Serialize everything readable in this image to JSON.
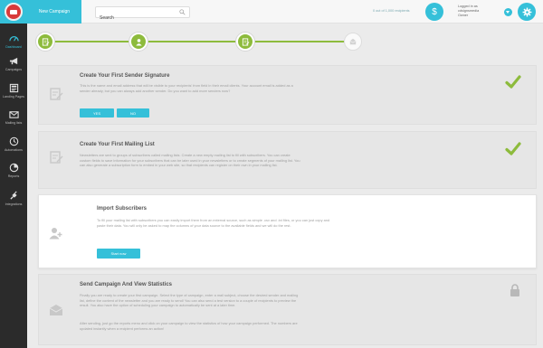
{
  "sidebar": {
    "items": [
      {
        "label": "Dashboard",
        "icon": "dashboard-icon"
      },
      {
        "label": "Campaigns",
        "icon": "megaphone-icon"
      },
      {
        "label": "Landing Pages",
        "icon": "landing-page-icon"
      },
      {
        "label": "Mailing lists",
        "icon": "mail-icon"
      },
      {
        "label": "Automations",
        "icon": "clock-icon"
      },
      {
        "label": "Reports",
        "icon": "pie-chart-icon"
      },
      {
        "label": "Integrations",
        "icon": "plug-icon"
      }
    ]
  },
  "header": {
    "new_campaign_label": "New Campaign",
    "search_placeholder": "Search",
    "credits_text": "0 out of 1,000 recipients",
    "logged_in_label": "Logged in as",
    "username": "cdsignsmedia",
    "role": "Owner"
  },
  "colors": {
    "accent": "#35c0d9",
    "success": "#8dbb3c",
    "sidebar": "#2b2b2b"
  },
  "progress": {
    "steps": [
      "done",
      "done",
      "done",
      "todo"
    ]
  },
  "cards": [
    {
      "title": "Create Your First Sender Signature",
      "desc": "This is the name and email address that will be visible to your recipients' from field in their email clients. Your account email is added as a sender already, but you can always add another sender. Do you want to add more senders now?",
      "yes_label": "YES",
      "no_label": "NO",
      "status": "complete"
    },
    {
      "title": "Create Your First Mailing List",
      "desc": "Newsletters are sent to groups of subscribers called mailing lists. Create a new empty mailing list to fill with subscribers. You can create custom fields to save information for your subscribers that can be later used in your newsletters or to create segments of your mailing list. You can also generate a subscription form to embed in your web site, so that recipients can register on their own in your mailing list.",
      "status": "complete"
    },
    {
      "title": "Import Subscribers",
      "desc": "To fill your mailing list with subscribers you can easily import them from an external source, such as simple .csv and .txt files, or you can just copy and paste their data. You will only be asked to map the columns of your data source to the available fields and we will do the rest.",
      "button_label": "Start now",
      "status": "current"
    },
    {
      "title": "Send Campaign And View Statistics",
      "desc": "Finally you are ready to create your first campaign. Select the type of campaign, enter a mail subject, choose the desired sender and mailing list, define the content of the newsletter and you are ready to send! You can also send a test version to a couple of recipients to preview the result. You also have the option of scheduling your campaign to automatically be sent at a later time.",
      "desc2": "After sending, just go the reports menu and click on your campaign to view the statistics of how your campaign performed. The numbers are updated instantly when a recipient performs an action!",
      "status": "locked"
    }
  ]
}
